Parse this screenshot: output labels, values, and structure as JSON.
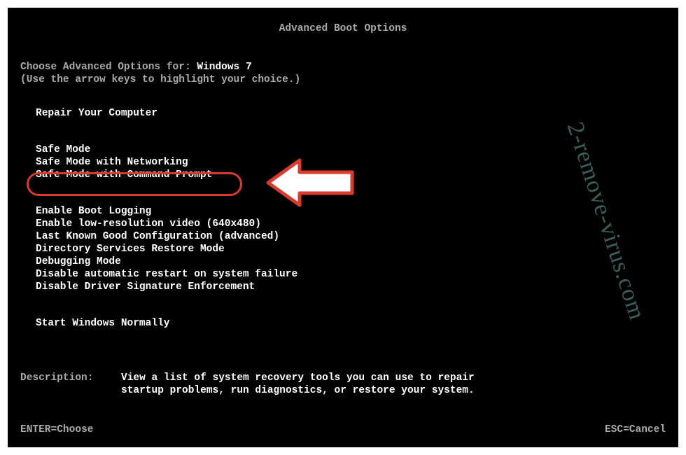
{
  "title": "Advanced Boot Options",
  "intro_prefix": "Choose Advanced Options for: ",
  "os_name": "Windows 7",
  "intro_hint": "(Use the arrow keys to highlight your choice.)",
  "highlighted_index": 3,
  "groups": [
    [
      "Repair Your Computer"
    ],
    [
      "Safe Mode",
      "Safe Mode with Networking",
      "Safe Mode with Command Prompt"
    ],
    [
      "Enable Boot Logging",
      "Enable low-resolution video (640x480)",
      "Last Known Good Configuration (advanced)",
      "Directory Services Restore Mode",
      "Debugging Mode",
      "Disable automatic restart on system failure",
      "Disable Driver Signature Enforcement"
    ],
    [
      "Start Windows Normally"
    ]
  ],
  "description_label": "Description:",
  "description_text": "View a list of system recovery tools you can use to repair startup problems, run diagnostics, or restore your system.",
  "footer_left": "ENTER=Choose",
  "footer_right": "ESC=Cancel",
  "watermark": "2-remove-virus.com",
  "annotation_color": "#d93a2b"
}
